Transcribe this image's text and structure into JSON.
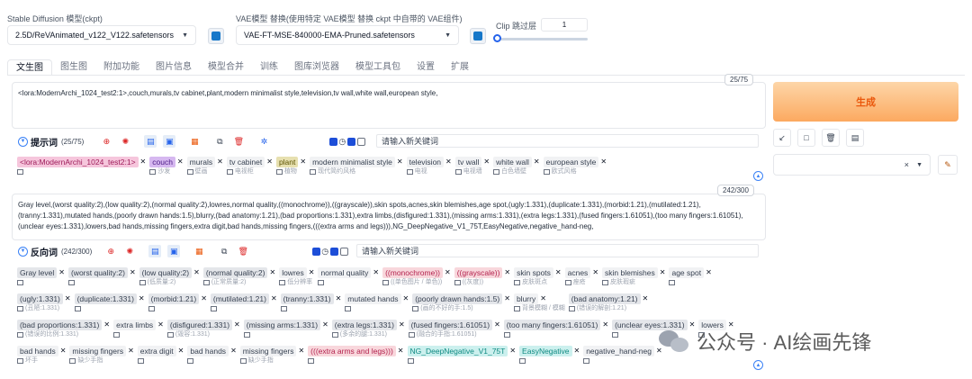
{
  "header": {
    "sd_model_label": "Stable Diffusion 模型(ckpt)",
    "sd_model_value": "2.5D/ReVAnimated_v122_V122.safetensors",
    "vae_label": "VAE模型 替换(使用特定 VAE模型 替换 ckpt 中自带的 VAE组件)",
    "vae_value": "VAE-FT-MSE-840000-EMA-Pruned.safetensors",
    "clip_label": "Clip 跳过层",
    "clip_value": "1",
    "clip_fraction": 0.0
  },
  "tabs": [
    {
      "label": "文生图",
      "active": true
    },
    {
      "label": "图生图"
    },
    {
      "label": "附加功能"
    },
    {
      "label": "图片信息"
    },
    {
      "label": "模型合并"
    },
    {
      "label": "训练"
    },
    {
      "label": "图库浏览器"
    },
    {
      "label": "模型工具包"
    },
    {
      "label": "设置"
    },
    {
      "label": "扩展"
    }
  ],
  "positive": {
    "counter": "25/75",
    "text": "<lora:ModernArchi_1024_test2:1>,couch,murals,tv cabinet,plant,modern minimalist style,television,tv wall,white wall,european style,",
    "title": "提示词",
    "count": "(25/75)",
    "new_keyword_placeholder": "请输入新关键词",
    "tags": [
      {
        "text": "<lora:ModernArchi_1024_test2:1>",
        "tr": "",
        "style": "lora"
      },
      {
        "text": "couch",
        "tr": "沙发",
        "style": "purple"
      },
      {
        "text": "murals",
        "tr": "壁画",
        "style": ""
      },
      {
        "text": "tv cabinet",
        "tr": "电视柜",
        "style": ""
      },
      {
        "text": "plant",
        "tr": "植物",
        "style": "olive"
      },
      {
        "text": "modern minimalist style",
        "tr": "现代简约风格",
        "style": ""
      },
      {
        "text": "television",
        "tr": "电视",
        "style": ""
      },
      {
        "text": "tv wall",
        "tr": "电视墙",
        "style": ""
      },
      {
        "text": "white wall",
        "tr": "白色墙壁",
        "style": ""
      },
      {
        "text": "european style",
        "tr": "欧式风格",
        "style": ""
      }
    ]
  },
  "negative": {
    "counter": "242/300",
    "text": "Gray level,(worst quality:2),(low quality:2),(normal quality:2),lowres,normal  quality,((monochrome)),((grayscale)),skin spots,acnes,skin blemishes,age  spot,(ugly:1.331),(duplicate:1.331),(morbid:1.21),(mutilated:1.21),(tranny:1.331),mutated  hands,(poorly drawn hands:1.5),blurry,(bad anatomy:1.21),(bad proportions:1.331),extra  limbs,(disfigured:1.331),(missing arms:1.331),(extra legs:1.331),(fused fingers:1.61051),(too  many fingers:1.61051),(unclear eyes:1.331),lowers,bad hands,missing fingers,extra digit,bad  hands,missing fingers,(((extra arms and  legs))),NG_DeepNegative_V1_75T,EasyNegative,negative_hand-neg,",
    "title": "反向词",
    "count": "(242/300)",
    "new_keyword_placeholder": "请输入新关键词",
    "rows": [
      [
        {
          "text": "Gray level",
          "tr": "",
          "style": "grey"
        },
        {
          "text": "(worst quality:2)",
          "tr": "",
          "style": "grey"
        },
        {
          "text": "(low quality:2)",
          "tr": "(低质量:2)",
          "style": "grey"
        },
        {
          "text": "(normal quality:2)",
          "tr": "(正常质量:2)",
          "style": "grey"
        },
        {
          "text": "lowres",
          "tr": "低分辨率",
          "style": ""
        },
        {
          "text": "normal  quality",
          "tr": "",
          "style": ""
        },
        {
          "text": "((monochrome))",
          "tr": "((单色图片 / 单色))",
          "style": "pinkred"
        },
        {
          "text": "((grayscale))",
          "tr": "((灰度))",
          "style": "pinkred"
        },
        {
          "text": "skin spots",
          "tr": "皮肤斑点",
          "style": ""
        },
        {
          "text": "acnes",
          "tr": "痤疮",
          "style": ""
        },
        {
          "text": "skin blemishes",
          "tr": "皮肤瑕疵",
          "style": ""
        },
        {
          "text": "age  spot",
          "tr": "",
          "style": ""
        }
      ],
      [
        {
          "text": "(ugly:1.331)",
          "tr": "(丑陋:1.331)",
          "style": "grey"
        },
        {
          "text": "(duplicate:1.331)",
          "tr": "",
          "style": "grey"
        },
        {
          "text": "(morbid:1.21)",
          "tr": "",
          "style": "grey"
        },
        {
          "text": "(mutilated:1.21)",
          "tr": "",
          "style": "grey"
        },
        {
          "text": "(tranny:1.331)",
          "tr": "",
          "style": "grey"
        },
        {
          "text": "mutated  hands",
          "tr": "",
          "style": ""
        },
        {
          "text": "(poorly drawn hands:1.5)",
          "tr": "(画的不好的手:1.5)",
          "style": "grey"
        },
        {
          "text": "blurry",
          "tr": "背景模糊 / 模糊",
          "style": ""
        },
        {
          "text": "(bad anatomy:1.21)",
          "tr": "(错误的解剖:1.21)",
          "style": "grey"
        }
      ],
      [
        {
          "text": "(bad proportions:1.331)",
          "tr": "(错误的比例:1.331)",
          "style": "grey"
        },
        {
          "text": "extra  limbs",
          "tr": "",
          "style": ""
        },
        {
          "text": "(disfigured:1.331)",
          "tr": "(毁容:1.331)",
          "style": "grey"
        },
        {
          "text": "(missing arms:1.331)",
          "tr": "",
          "style": "grey"
        },
        {
          "text": "(extra legs:1.331)",
          "tr": "(多余的腿:1.331)",
          "style": "grey"
        },
        {
          "text": "(fused fingers:1.61051)",
          "tr": "(融合的手指:1.61051)",
          "style": "grey"
        },
        {
          "text": "(too  many fingers:1.61051)",
          "tr": "",
          "style": "grey"
        },
        {
          "text": "(unclear eyes:1.331)",
          "tr": "",
          "style": "grey"
        },
        {
          "text": "lowers",
          "tr": "",
          "style": ""
        }
      ],
      [
        {
          "text": "bad hands",
          "tr": "坏手",
          "style": ""
        },
        {
          "text": "missing fingers",
          "tr": "缺少手指",
          "style": ""
        },
        {
          "text": "extra digit",
          "tr": "",
          "style": ""
        },
        {
          "text": "bad  hands",
          "tr": "",
          "style": ""
        },
        {
          "text": "missing fingers",
          "tr": "缺少手指",
          "style": ""
        },
        {
          "text": "(((extra arms and  legs)))",
          "tr": "",
          "style": "pinkred"
        },
        {
          "text": "NG_DeepNegative_V1_75T",
          "tr": "",
          "style": "teal"
        },
        {
          "text": "EasyNegative",
          "tr": "",
          "style": "teal"
        },
        {
          "text": "negative_hand-neg",
          "tr": "",
          "style": ""
        }
      ]
    ]
  },
  "sidebar": {
    "generate_label": "生成"
  },
  "watermark": {
    "text": "公众号 · AI绘画先锋"
  }
}
